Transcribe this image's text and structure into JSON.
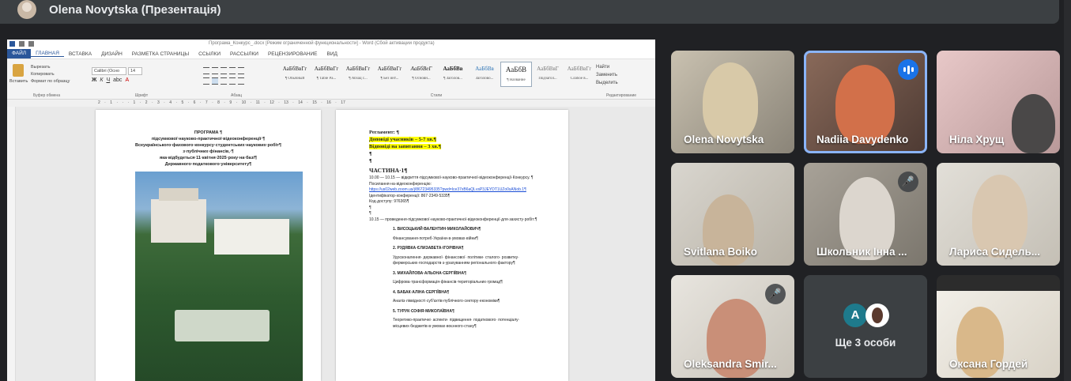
{
  "meeting": {
    "presenter_title": "Olena Novytska (Презентація)"
  },
  "word": {
    "window_title": "Програма_Конкурс_.docx [Режим ограниченной функциональности] - Word (Сбой активации продукта)",
    "tabs": [
      "ФАЙЛ",
      "ГЛАВНАЯ",
      "ВСТАВКА",
      "ДИЗАЙН",
      "РАЗМЕТКА СТРАНИЦЫ",
      "ССЫЛКИ",
      "РАССЫЛКИ",
      "РЕЦЕНЗИРОВАНИЕ",
      "ВИД"
    ],
    "clipboard": {
      "paste": "Вставить",
      "cut": "Вырезать",
      "copy": "Копировать",
      "format": "Формат по образцу",
      "group": "Буфер обмена"
    },
    "font": {
      "name": "Calibri (Осно",
      "size": "14",
      "group": "Шрифт"
    },
    "paragraph_group": "Абзац",
    "styles": [
      {
        "sample": "АаБбВвГг",
        "name": "¶ Обычный"
      },
      {
        "sample": "АаБбВвГг",
        "name": "¶ Table Pa..."
      },
      {
        "sample": "АаБбВвГг",
        "name": "¶ Абзац с..."
      },
      {
        "sample": "АаБбВвГг",
        "name": "¶ Без инт..."
      },
      {
        "sample": "АаБбВеГ",
        "name": "¶ Основн..."
      },
      {
        "sample": "АаБбВв",
        "name": "¶ Заголов..."
      },
      {
        "sample": "АаБбВв",
        "name": "Заголово..."
      },
      {
        "sample": "АаБбВ",
        "name": "¶ Название"
      },
      {
        "sample": "АаБбВвГ",
        "name": "Подзагол..."
      },
      {
        "sample": "АаБбВвГг",
        "name": "Слабое в..."
      },
      {
        "sample": "АаБбВвГг",
        "name": "..."
      }
    ],
    "styles_group": "Стили",
    "editing": {
      "find": "Найти",
      "replace": "Заменить",
      "select": "Выделить",
      "group": "Редактирование"
    },
    "ruler_numbers": "2 · 1 · · · 1 · 2 · 3 · 4 · 5 · 6 · 7 · 8 · 9 · 10 · 11 · 12 · 13 · 14 · 15 · 16 · 17",
    "page1": {
      "lines": [
        "ПРОГРАМА ¶",
        "підсумкової·науково-практичної·відеоконференції·¶",
        "Всеукраїнського·фахового·конкурсу·студентських·наукових·робіт¶",
        "з·публічних·фінансів,·¶",
        "яка·відбудеться·11·квітня·2025·року·на·базі¶",
        "Державного·податкового·університету¶"
      ]
    },
    "page2": {
      "reglament": "Регламент: ¶",
      "report": "Доповіді учасників – 5-7 хв.¶",
      "answers": "Відповіді на запитання – 3 хв.¶",
      "pilcrow": "¶",
      "part": "ЧАСТИНА·1¶",
      "opening": "10.00 — 10.15 — відкриття·підсумкової·науково-практичної·відеоконференції·Конкурсу. ¶",
      "link_label": "Посилання·на·відеоконференцію:",
      "link": "https://us02web.zoom.us/j/86723495335?pwd=Ice37xB6aQLvsP3JEYDT1UZo0sANob.1¶",
      "conf_id": "Ідентифікатор·конференції: 867·2349·5335¶",
      "code": "Код·доступу: 976365¶",
      "session": "10.15 — проведення·підсумкової·науково-практичної·відеоконференції·для·захисту·робіт:¶",
      "items": [
        {
          "name": "1. ВИСОЦЬКИЙ·ВАЛЕНТИН·МИКОЛАЙОВИЧ¶",
          "topic": "Фінансування·потреб·України·в·умовах·війни¶"
        },
        {
          "name": "2. РУДЯВКА·ЄЛИЗАВЕТА·ІГОРІВНА¶",
          "topic": "Удосконалення· державної· фінансової· політики· сталого· розвитку· фермерських·господарств·з·урахуванням·регіонального·фактору¶"
        },
        {
          "name": "3. МИХАЙЛОВА·АЛЬОНА·СЕРГІЇВНА¶",
          "topic": "Цифрова·трансформація·фінансів·територіальних·громад¶"
        },
        {
          "name": "4. БАБАК·АЛІНА·СЕРГІЇВНА¶",
          "topic": "Аналіз·ліквідності·суб'єктів·публічного·сектору·економіки¶"
        },
        {
          "name": "5. ТУРУК·СОФІЯ·МИКОЛАЇВНА¶",
          "topic": "Теоретико-практичні· аспекти· підвищення· податкового· потенціалу· місцевих·бюджетів·в·умовах·воєнного·стану¶"
        }
      ]
    }
  },
  "participants": [
    {
      "name": "Olena Novytska",
      "muted": false,
      "speaking": false
    },
    {
      "name": "Nadiia Davydenko",
      "muted": false,
      "speaking": true
    },
    {
      "name": "Ніла Хрущ",
      "muted": false,
      "speaking": false
    },
    {
      "name": "Svitlana Boiko",
      "muted": false,
      "speaking": false
    },
    {
      "name": "Школьник Інна ...",
      "muted": true,
      "speaking": false
    },
    {
      "name": "Лариса Сидель...",
      "muted": false,
      "speaking": false
    },
    {
      "name": "Oleksandra Smir...",
      "muted": true,
      "speaking": false
    },
    {
      "name": "Оксана Гордей",
      "muted": false,
      "speaking": false
    }
  ],
  "more_tile": {
    "initial": "A",
    "label": "Ще 3 особи"
  },
  "colors": {
    "speaking": "#1a73e8",
    "tile_bg": "#3c4043",
    "highlight": "#ffff00"
  }
}
